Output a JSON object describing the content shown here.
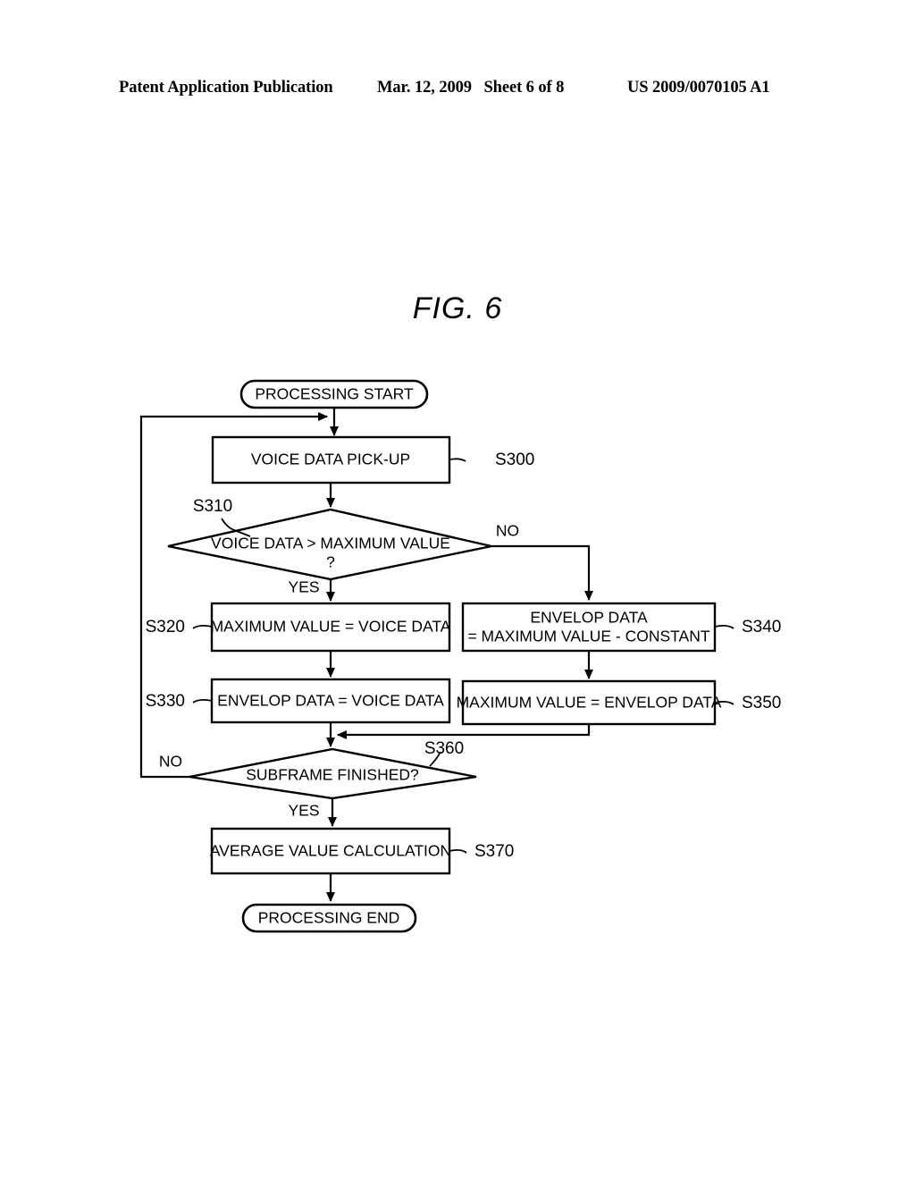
{
  "header": {
    "publication": "Patent Application Publication",
    "date": "Mar. 12, 2009",
    "sheet": "Sheet 6 of 8",
    "patent_number": "US 2009/0070105 A1"
  },
  "figure": {
    "title": "FIG. 6"
  },
  "flowchart": {
    "nodes": {
      "start": {
        "label": "PROCESSING START",
        "shape": "terminal"
      },
      "s300": {
        "label": "VOICE DATA PICK-UP",
        "step": "S300",
        "shape": "process"
      },
      "s310": {
        "label": "VOICE DATA > MAXIMUM VALUE",
        "label2": "?",
        "step": "S310",
        "shape": "decision"
      },
      "s320": {
        "label": "MAXIMUM VALUE = VOICE DATA",
        "step": "S320",
        "shape": "process"
      },
      "s330": {
        "label": "ENVELOP DATA = VOICE DATA",
        "step": "S330",
        "shape": "process"
      },
      "s340": {
        "label": "ENVELOP DATA",
        "label2": "= MAXIMUM VALUE - CONSTANT",
        "step": "S340",
        "shape": "process"
      },
      "s350": {
        "label": "MAXIMUM VALUE = ENVELOP DATA",
        "step": "S350",
        "shape": "process"
      },
      "s360": {
        "label": "SUBFRAME FINISHED?",
        "step": "S360",
        "shape": "decision"
      },
      "s370": {
        "label": "AVERAGE VALUE CALCULATION",
        "step": "S370",
        "shape": "process"
      },
      "end": {
        "label": "PROCESSING END",
        "shape": "terminal"
      }
    },
    "branch_labels": {
      "s310_yes": "YES",
      "s310_no": "NO",
      "s360_yes": "YES",
      "s360_no": "NO"
    },
    "colors": {
      "ink": "#000000",
      "paper": "#ffffff"
    }
  }
}
